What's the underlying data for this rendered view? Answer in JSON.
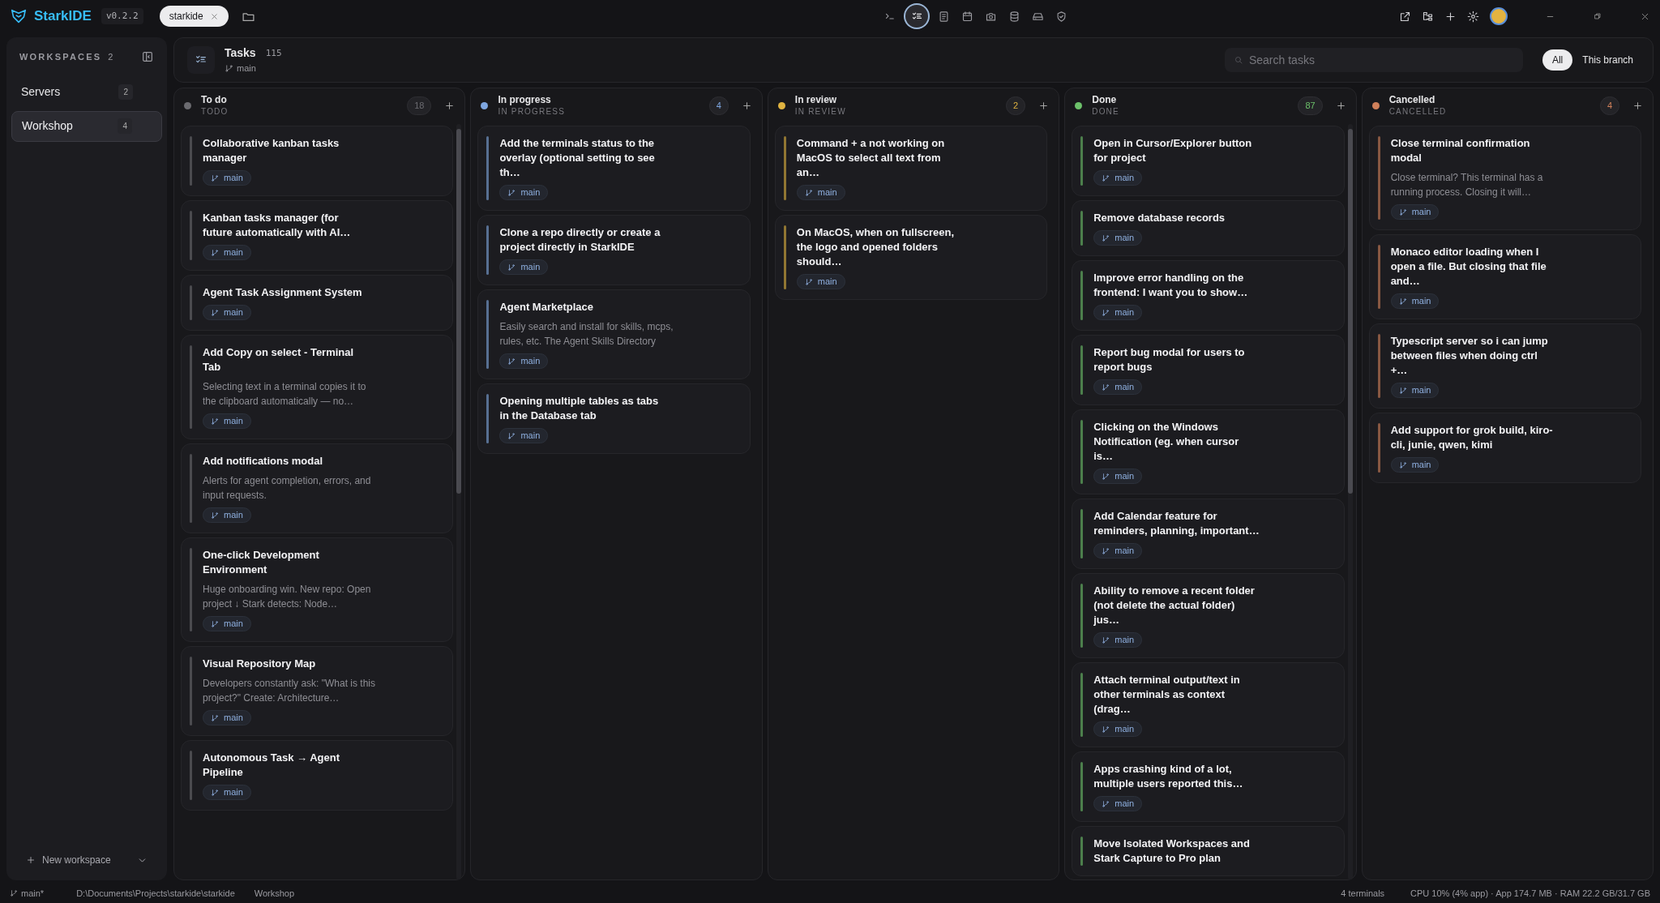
{
  "app": {
    "name": "StarkIDE",
    "version": "v0.2.2"
  },
  "project_tabs": [
    {
      "label": "starkide",
      "selected": true
    }
  ],
  "toolbar": [
    {
      "kind": "terminal",
      "selected": false
    },
    {
      "kind": "tasks",
      "selected": true
    },
    {
      "kind": "notebook",
      "selected": false
    },
    {
      "kind": "calendar",
      "selected": false
    },
    {
      "kind": "camera",
      "selected": false
    },
    {
      "kind": "database",
      "selected": false
    },
    {
      "kind": "drive",
      "selected": false
    },
    {
      "kind": "shield",
      "selected": false
    }
  ],
  "sidebar": {
    "title": "WORKSPACES",
    "count": "2",
    "items": [
      {
        "label": "Servers",
        "count": "2",
        "selected": false
      },
      {
        "label": "Workshop",
        "count": "4",
        "selected": true
      }
    ],
    "new_button": "New workspace"
  },
  "header": {
    "title": "Tasks",
    "count": "115",
    "branch": "main",
    "search": {
      "placeholder": "Search tasks"
    },
    "filters": [
      {
        "label": "All",
        "selected": true
      },
      {
        "label": "This branch",
        "selected": false
      }
    ]
  },
  "columns": [
    {
      "title": "To do",
      "subtitle": "TODO",
      "count": "18",
      "color": "#6b6b70",
      "scrollbar": true,
      "cards": [
        {
          "title": "Collaborative kanban tasks manager",
          "branch": "main"
        },
        {
          "title": "Kanban tasks manager (for future automatically with AI…",
          "branch": "main"
        },
        {
          "title": "Agent Task Assignment System",
          "branch": "main"
        },
        {
          "title": "Add Copy on select - Terminal Tab",
          "description": "Selecting text in a terminal copies it to the clipboard automatically — no…",
          "branch": "main"
        },
        {
          "title": "Add notifications modal",
          "description": "Alerts for agent completion, errors, and input requests.",
          "branch": "main"
        },
        {
          "title": "One-click Development Environment",
          "description": "Huge onboarding win. New repo: Open project ↓ Stark detects: Node…",
          "branch": "main"
        },
        {
          "title": "Visual Repository Map",
          "description": "Developers constantly ask: \"What is this project?\" Create: Architecture…",
          "branch": "main"
        },
        {
          "title": "Autonomous Task → Agent Pipeline",
          "branch": "main"
        }
      ]
    },
    {
      "title": "In progress",
      "subtitle": "IN PROGRESS",
      "count": "4",
      "color": "#7ea6e0",
      "scrollbar": false,
      "cards": [
        {
          "title": "Add the terminals status to the overlay (optional setting to see th…",
          "branch": "main"
        },
        {
          "title": "Clone a repo directly or create a project directly in StarkIDE",
          "branch": "main"
        },
        {
          "title": "Agent Marketplace",
          "description": "Easily search and install for skills, mcps, rules, etc. The Agent Skills Directory",
          "branch": "main"
        },
        {
          "title": "Opening multiple tables as tabs in the Database tab",
          "branch": "main"
        }
      ]
    },
    {
      "title": "In review",
      "subtitle": "IN REVIEW",
      "count": "2",
      "color": "#e0b340",
      "scrollbar": false,
      "cards": [
        {
          "title": "Command + a not working on MacOS to select all text from an…",
          "branch": "main"
        },
        {
          "title": "On MacOS, when on fullscreen, the logo and opened folders should…",
          "branch": "main"
        }
      ]
    },
    {
      "title": "Done",
      "subtitle": "DONE",
      "count": "87",
      "color": "#6cc16a",
      "scrollbar": true,
      "cards": [
        {
          "title": "Open in Cursor/Explorer button for project",
          "branch": "main"
        },
        {
          "title": "Remove database records",
          "branch": "main"
        },
        {
          "title": "Improve error handling on the frontend: I want you to show…",
          "branch": "main"
        },
        {
          "title": "Report bug modal for users to report bugs",
          "branch": "main"
        },
        {
          "title": "Clicking on the Windows Notification (eg. when cursor is…",
          "branch": "main"
        },
        {
          "title": "Add Calendar feature for reminders, planning, important…",
          "branch": "main"
        },
        {
          "title": "Ability to remove a recent folder (not delete the actual folder) jus…",
          "branch": "main"
        },
        {
          "title": "Attach terminal output/text in other terminals as context (drag…",
          "branch": "main"
        },
        {
          "title": "Apps crashing kind of a lot, multiple users reported this…",
          "branch": "main"
        },
        {
          "title": "Move Isolated Workspaces and Stark Capture to Pro plan"
        }
      ]
    },
    {
      "title": "Cancelled",
      "subtitle": "CANCELLED",
      "count": "4",
      "color": "#d0805a",
      "scrollbar": false,
      "cards": [
        {
          "title": "Close terminal confirmation modal",
          "description": "Close terminal? This terminal has a running process. Closing it will…",
          "branch": "main"
        },
        {
          "title": "Monaco editor loading when I open a file. But closing that file and…",
          "branch": "main"
        },
        {
          "title": "Typescript server so i can jump between files when doing ctrl +…",
          "branch": "main"
        },
        {
          "title": "Add support for grok build, kiro-cli, junie, qwen, kimi",
          "branch": "main"
        }
      ]
    }
  ],
  "status_bar": {
    "branch": "main*",
    "path": "D:\\Documents\\Projects\\starkide\\starkide",
    "workspace": "Workshop",
    "terminals": "4 terminals",
    "resources": "CPU 10% (4% app) · App 174.7 MB · RAM 22.2 GB/31.7 GB"
  }
}
